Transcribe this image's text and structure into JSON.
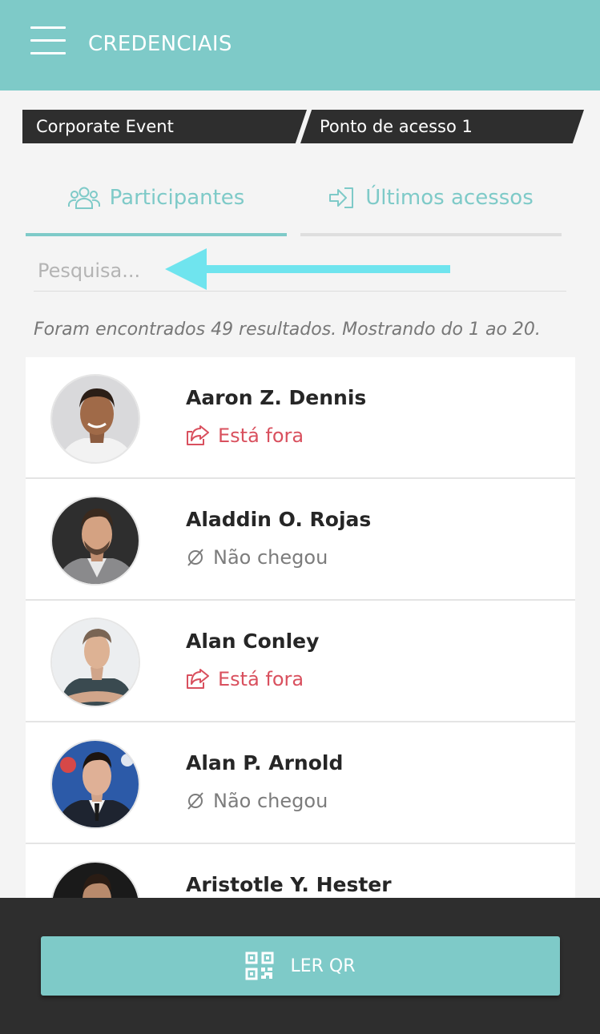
{
  "header": {
    "title": "CREDENCIAIS",
    "menu_icon": "hamburger-menu-icon"
  },
  "breadcrumb": {
    "event": "Corporate Event",
    "access_point": "Ponto de acesso 1"
  },
  "tabs": [
    {
      "label": "Participantes",
      "icon": "users-icon",
      "active": true
    },
    {
      "label": "Últimos acessos",
      "icon": "sign-in-icon",
      "active": false
    }
  ],
  "search": {
    "placeholder": "Pesquisa...",
    "value": ""
  },
  "results_text": "Foram encontrados 49 resultados. Mostrando do 1 ao 20.",
  "participants": [
    {
      "name": "Aaron Z. Dennis",
      "status": "Está fora",
      "status_type": "out",
      "status_icon": "share-out-icon"
    },
    {
      "name": "Aladdin O. Rojas",
      "status": "Não chegou",
      "status_type": "none",
      "status_icon": "empty-set-icon"
    },
    {
      "name": "Alan Conley",
      "status": "Está fora",
      "status_type": "out",
      "status_icon": "share-out-icon"
    },
    {
      "name": "Alan P. Arnold",
      "status": "Não chegou",
      "status_type": "none",
      "status_icon": "empty-set-icon"
    },
    {
      "name": "Aristotle Y. Hester",
      "status": "",
      "status_type": "",
      "status_icon": ""
    }
  ],
  "footer": {
    "button_label": "LER QR",
    "button_icon": "qr-code-icon"
  },
  "colors": {
    "accent": "#7ecac8",
    "dark": "#2e2e2e",
    "out": "#d9505e",
    "muted": "#7c7c7c",
    "arrow": "#6fe4ee"
  }
}
